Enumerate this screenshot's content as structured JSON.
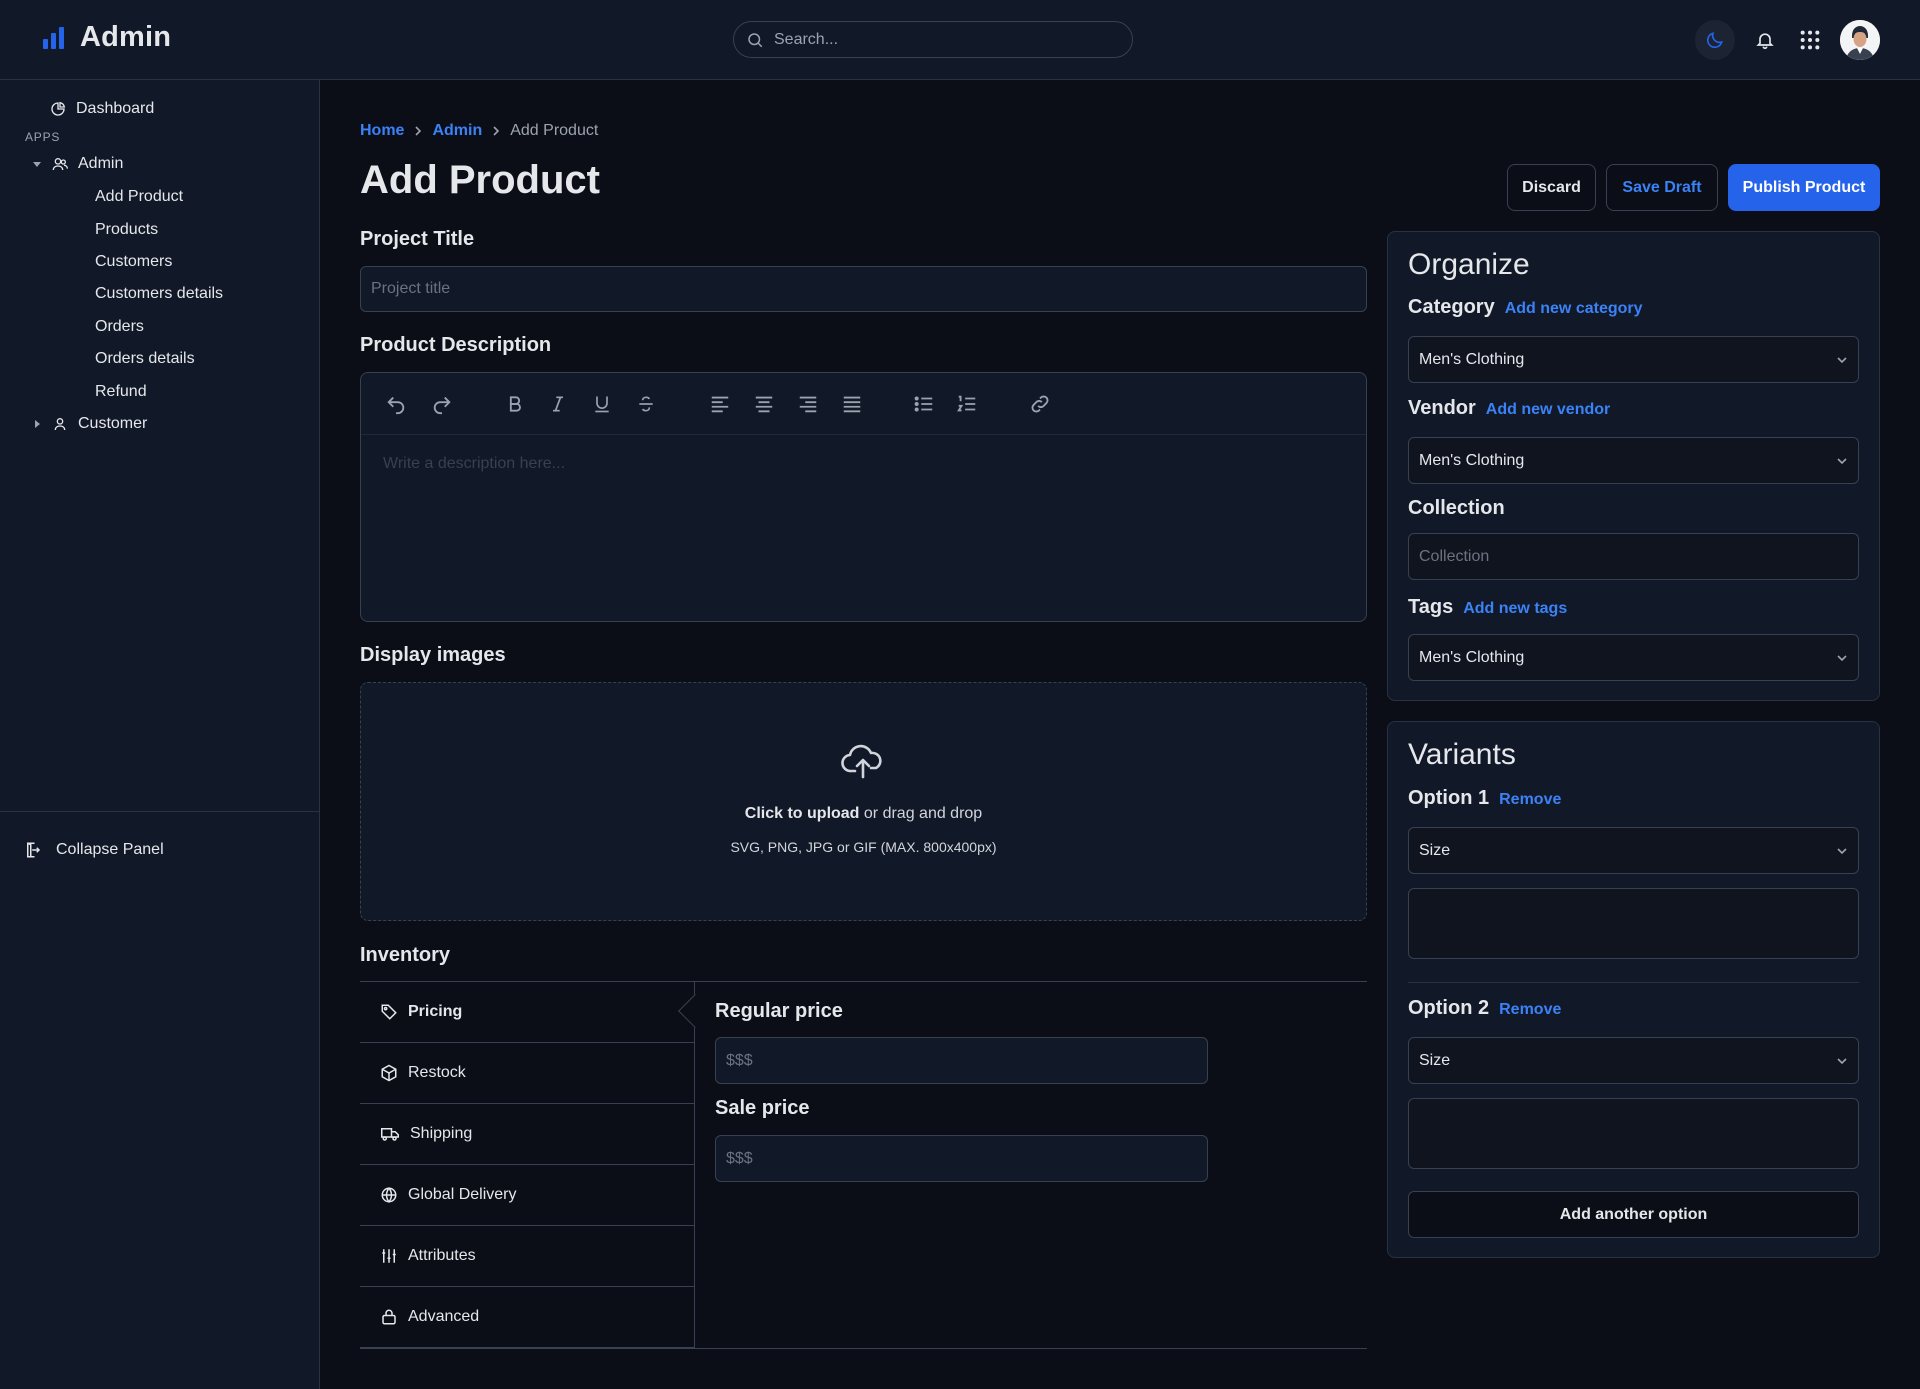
{
  "app": {
    "name": "Admin",
    "search_placeholder": "Search..."
  },
  "sidebar": {
    "dashboard": "Dashboard",
    "section_label": "APPS",
    "admin": {
      "label": "Admin",
      "items": [
        "Add Product",
        "Products",
        "Customers",
        "Customers details",
        "Orders",
        "Orders details",
        "Refund"
      ]
    },
    "customer": "Customer",
    "collapse": "Collapse Panel"
  },
  "breadcrumb": [
    "Home",
    "Admin",
    "Add Product"
  ],
  "page": {
    "title": "Add Product",
    "actions": {
      "discard": "Discard",
      "save_draft": "Save Draft",
      "publish": "Publish Product"
    }
  },
  "form": {
    "project_title": {
      "label": "Project Title",
      "placeholder": "Project title"
    },
    "description": {
      "label": "Product Description",
      "placeholder": "Write a description here..."
    },
    "images": {
      "label": "Display images",
      "upload_link": "Click to upload",
      "upload_rest": " or drag and drop",
      "hint": "SVG, PNG, JPG or GIF (MAX. 800x400px)"
    },
    "inventory": {
      "label": "Inventory",
      "tabs": [
        "Pricing",
        "Restock",
        "Shipping",
        "Global Delivery",
        "Attributes",
        "Advanced"
      ],
      "active_tab": "Pricing",
      "regular_price": {
        "label": "Regular price",
        "placeholder": "$$$"
      },
      "sale_price": {
        "label": "Sale price",
        "placeholder": "$$$"
      }
    }
  },
  "organize": {
    "title": "Organize",
    "category": {
      "label": "Category",
      "link": "Add new category",
      "value": "Men's Clothing"
    },
    "vendor": {
      "label": "Vendor",
      "link": "Add new vendor",
      "value": "Men's Clothing"
    },
    "collection": {
      "label": "Collection",
      "placeholder": "Collection"
    },
    "tags": {
      "label": "Tags",
      "link": "Add new tags",
      "value": "Men's Clothing"
    }
  },
  "variants": {
    "title": "Variants",
    "option1": {
      "label": "Option 1",
      "link": "Remove",
      "value": "Size"
    },
    "option2": {
      "label": "Option 2",
      "link": "Remove",
      "value": "Size"
    },
    "add_option": "Add another option"
  },
  "colors": {
    "accent": "#2563eb",
    "link": "#3b82f6",
    "background": "#0b0e16",
    "panel": "#111827"
  }
}
